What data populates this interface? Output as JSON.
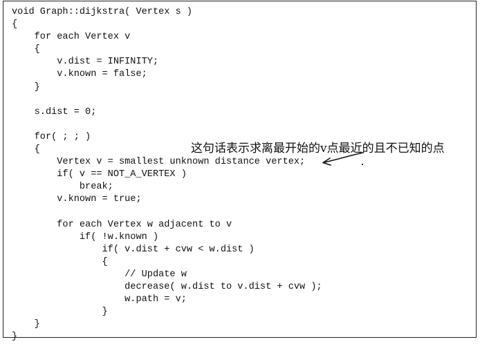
{
  "code": {
    "lines": [
      "void Graph::dijkstra( Vertex s )",
      "{",
      "    for each Vertex v",
      "    {",
      "        v.dist = INFINITY;",
      "        v.known = false;",
      "    }",
      "",
      "    s.dist = 0;",
      "",
      "    for( ; ; )",
      "    {",
      "        Vertex v = smallest unknown distance vertex;",
      "        if( v == NOT_A_VERTEX )",
      "            break;",
      "        v.known = true;",
      "",
      "        for each Vertex w adjacent to v",
      "            if( !w.known )",
      "                if( v.dist + cvw < w.dist )",
      "                {",
      "                    // Update w",
      "                    decrease( w.dist to v.dist + cvw );",
      "                    w.path = v;",
      "                }",
      "    }",
      "}"
    ]
  },
  "annotation": {
    "text": "这句话表示求离最开始的v点最近的且不已知的点"
  }
}
